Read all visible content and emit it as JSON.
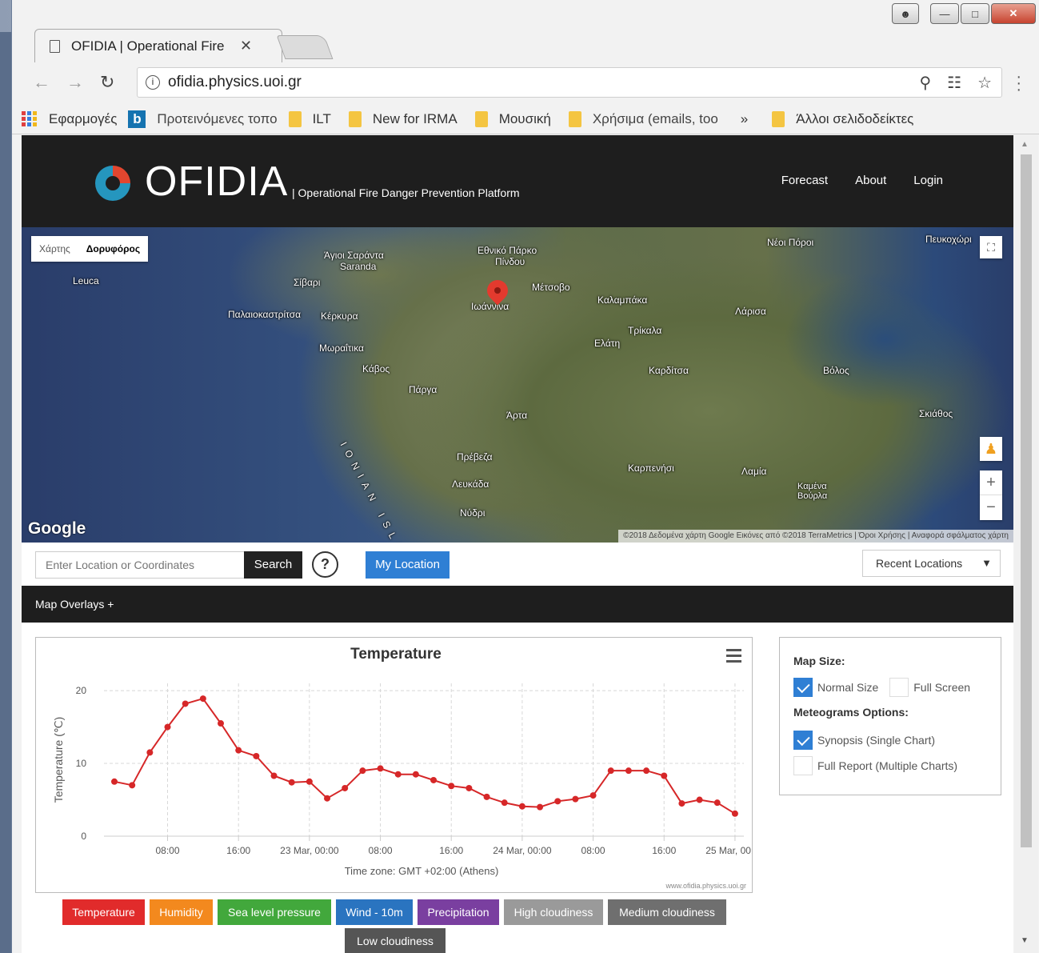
{
  "browser": {
    "tab_title": "OFIDIA | Operational Fire",
    "url": "ofidia.physics.uoi.gr",
    "bookmarks": [
      {
        "label": "Εφαρμογές",
        "icon": "apps-grid-icon"
      },
      {
        "label": "Προτεινόμενες τοπο",
        "icon": "bing-icon"
      },
      {
        "label": "ILT",
        "icon": "folder-icon"
      },
      {
        "label": "New for IRMA",
        "icon": "folder-icon"
      },
      {
        "label": "Μουσική",
        "icon": "folder-icon"
      },
      {
        "label": "Χρήσιμα (emails, too",
        "icon": "folder-icon"
      },
      {
        "label": "»",
        "icon": "overflow-chevron-icon"
      },
      {
        "label": "Άλλοι σελιδοδείκτες",
        "icon": "folder-icon"
      }
    ]
  },
  "header": {
    "brand": "OFIDIA",
    "tagline": "| Operational Fire Danger Prevention Platform",
    "nav": [
      "Forecast",
      "About",
      "Login"
    ]
  },
  "map": {
    "type_toggle": {
      "map": "Χάρτης",
      "satellite": "Δορυφόρος",
      "selected": "Δορυφόρος"
    },
    "labels": [
      {
        "text": "Άγιοι Σαράντα",
        "key": "a"
      },
      {
        "text": "Saranda",
        "key": "b"
      },
      {
        "text": "Εθνικό Πάρκο",
        "key": "c"
      },
      {
        "text": "Πίνδου",
        "key": "d"
      },
      {
        "text": "Σίβαρι",
        "key": "e"
      },
      {
        "text": "Μέτσοβο",
        "key": "f"
      },
      {
        "text": "Καλαμπάκα",
        "key": "g"
      },
      {
        "text": "Λάρισα",
        "key": "h"
      },
      {
        "text": "Παλαιοκαστρίτσα",
        "key": "i"
      },
      {
        "text": "Κέρκυρα",
        "key": "j"
      },
      {
        "text": "Ιωάννινα",
        "key": "k"
      },
      {
        "text": "Τρίκαλα",
        "key": "l"
      },
      {
        "text": "Μωραΐτικα",
        "key": "m"
      },
      {
        "text": "Κάβος",
        "key": "n"
      },
      {
        "text": "Ελάτη",
        "key": "o"
      },
      {
        "text": "Καρδίτσα",
        "key": "p"
      },
      {
        "text": "Βόλος",
        "key": "q"
      },
      {
        "text": "Πάργα",
        "key": "r"
      },
      {
        "text": "Άρτα",
        "key": "s"
      },
      {
        "text": "Σκιάθος",
        "key": "t"
      },
      {
        "text": "Πρέβεζα",
        "key": "u"
      },
      {
        "text": "Λευκάδα",
        "key": "v"
      },
      {
        "text": "Καρπενήσι",
        "key": "w"
      },
      {
        "text": "Λαμία",
        "key": "x"
      },
      {
        "text": "Καμένα Βούρλα",
        "key": "y"
      },
      {
        "text": "Νέοι Πόροι",
        "key": "z"
      },
      {
        "text": "Πευκοχώρι",
        "key": "aa"
      },
      {
        "text": "Leuca",
        "key": "ab"
      },
      {
        "text": "IONIAN ISLA",
        "key": "ac"
      },
      {
        "text": "Νύδρι",
        "key": "ad"
      }
    ],
    "google": "Google",
    "attribution": "©2018 Δεδομένα χάρτη Google Εικόνες από ©2018 TerraMetrics | Όροι Χρήσης | Αναφορά σφάλματος χάρτη"
  },
  "search": {
    "placeholder": "Enter Location or Coordinates",
    "button": "Search",
    "help": "?",
    "my_location": "My Location",
    "recent": "Recent Locations"
  },
  "overlays_label": "Map Overlays +",
  "options": {
    "map_size_title": "Map Size:",
    "normal_size": "Normal Size",
    "full_screen": "Full Screen",
    "meteogram_title": "Meteograms Options:",
    "synopsis": "Synopsis (Single Chart)",
    "full_report": "Full Report (Multiple Charts)",
    "normal_size_checked": true,
    "full_screen_checked": false,
    "synopsis_checked": true,
    "full_report_checked": false
  },
  "chart_data": {
    "type": "line",
    "title": "Temperature",
    "ylabel": "Temperature (℃)",
    "xlabel": "Time zone: GMT +02:00 (Athens)",
    "credit": "www.ofidia.physics.uoi.gr",
    "ylim": [
      0,
      21
    ],
    "yticks": [
      0,
      10,
      20
    ],
    "grid": true,
    "x_start": "22 Mar, 02:00",
    "x_step_hours": 2,
    "xtick_labels": [
      "08:00",
      "16:00",
      "23 Mar, 00:00",
      "08:00",
      "16:00",
      "24 Mar, 00:00",
      "08:00",
      "16:00",
      "25 Mar, 00:00"
    ],
    "xtick_index": [
      3,
      7,
      11,
      15,
      19,
      23,
      27,
      31,
      35
    ],
    "series": [
      {
        "color": "#d62728",
        "values": [
          7.5,
          7.0,
          11.5,
          15.0,
          18.2,
          18.9,
          15.5,
          11.8,
          11.0,
          8.3,
          7.4,
          7.5,
          5.2,
          6.6,
          9.0,
          9.3,
          8.5,
          8.5,
          7.7,
          6.9,
          6.6,
          5.4,
          4.6,
          4.1,
          4.0,
          4.8,
          5.1,
          5.6,
          9.0,
          9.0,
          9.0,
          8.3,
          4.5,
          5.0,
          4.6,
          3.1
        ]
      }
    ],
    "colors": {
      "background": "#ffffff",
      "grid": "#d8d8d8"
    }
  },
  "variable_buttons": [
    {
      "label": "Temperature",
      "color": "#e12b2b"
    },
    {
      "label": "Humidity",
      "color": "#f3891e"
    },
    {
      "label": "Sea level pressure",
      "color": "#42a83c"
    },
    {
      "label": "Wind - 10m",
      "color": "#2a74c0"
    },
    {
      "label": "Precipitation",
      "color": "#7a3fa0"
    },
    {
      "label": "High cloudiness",
      "color": "#9a9a9a"
    },
    {
      "label": "Medium cloudiness",
      "color": "#6f6f6f"
    },
    {
      "label": "Low cloudiness",
      "color": "#555555"
    }
  ]
}
